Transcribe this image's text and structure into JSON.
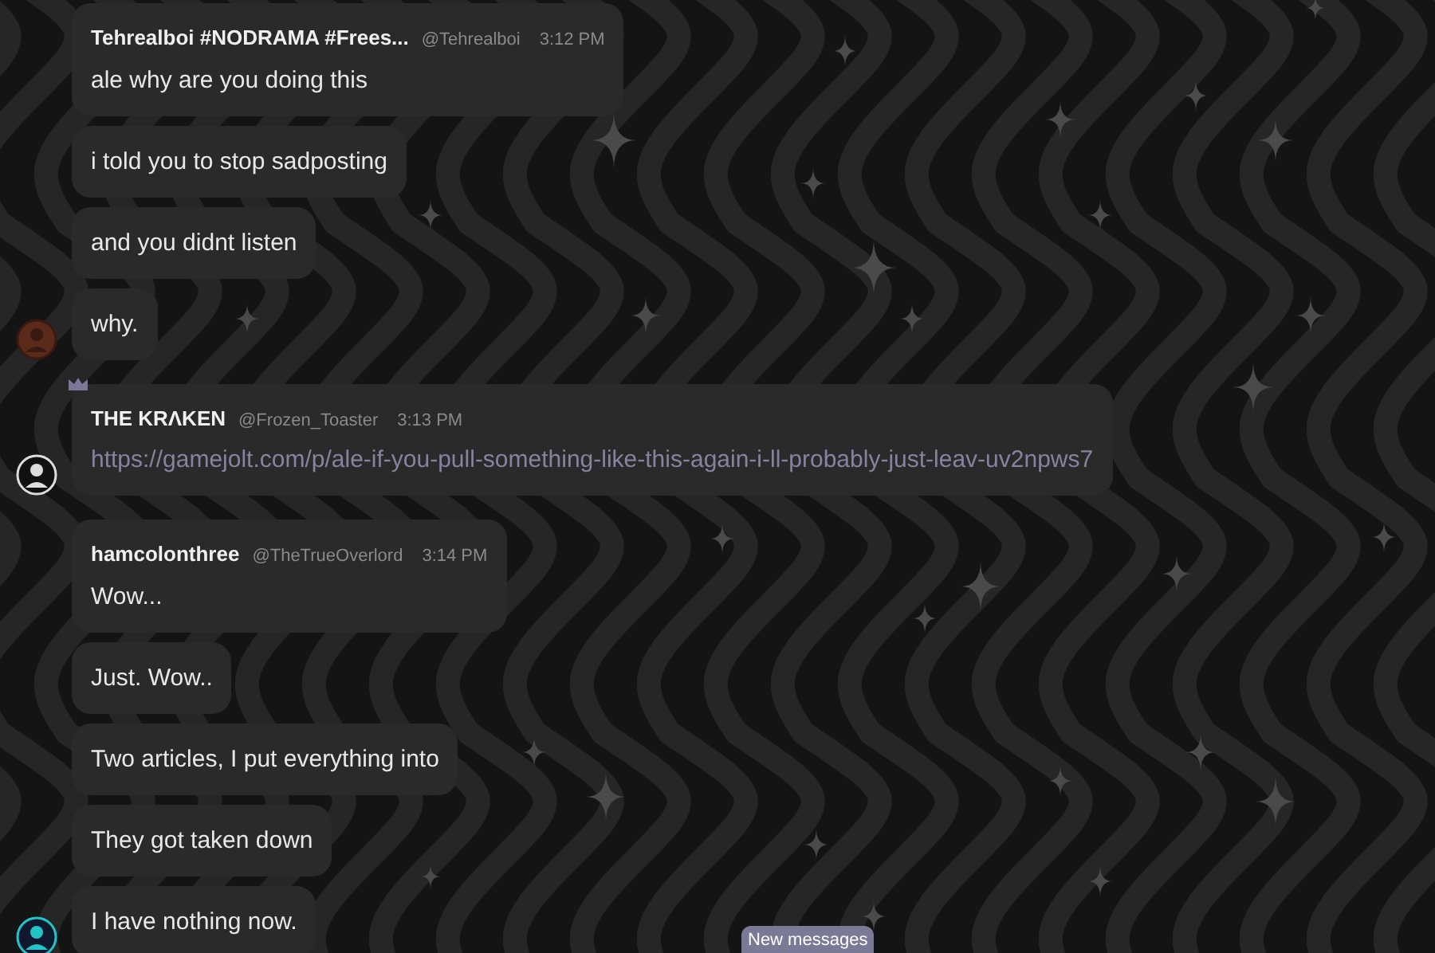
{
  "groups": [
    {
      "author": "Tehrealboi #NODRAMA #Frees...",
      "handle": "@Tehrealboi",
      "time": "3:12 PM",
      "crown": false,
      "messages": [
        {
          "kind": "text",
          "text": "ale why are you doing this"
        },
        {
          "kind": "text",
          "text": "i told you to stop sadposting"
        },
        {
          "kind": "text",
          "text": "and you didnt listen"
        },
        {
          "kind": "text",
          "text": "why."
        }
      ]
    },
    {
      "author": "THE KRΛKEN",
      "handle": "@Frozen_Toaster",
      "time": "3:13 PM",
      "crown": true,
      "messages": [
        {
          "kind": "link",
          "text": "https://gamejolt.com/p/ale-if-you-pull-something-like-this-again-i-ll-probably-just-leav-uv2npws7"
        }
      ]
    },
    {
      "author": "hamcolonthree",
      "handle": "@TheTrueOverlord",
      "time": "3:14 PM",
      "crown": false,
      "messages": [
        {
          "kind": "text",
          "text": "Wow..."
        },
        {
          "kind": "text",
          "text": "Just. Wow.."
        },
        {
          "kind": "text",
          "text": "Two articles, I put everything into"
        },
        {
          "kind": "text",
          "text": "They got taken down"
        },
        {
          "kind": "text",
          "text": "I have nothing now."
        }
      ]
    }
  ],
  "new_messages": "New messages"
}
